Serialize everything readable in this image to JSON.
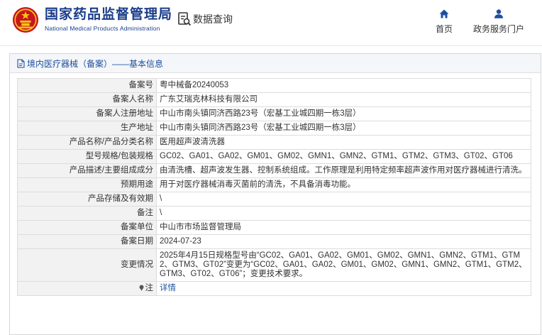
{
  "header": {
    "agency_cn": "国家药品监督管理局",
    "agency_en": "National Medical Products Administration",
    "query_label": "数据查询",
    "nav": [
      {
        "label": "首页",
        "icon": "home-icon"
      },
      {
        "label": "政务服务门户",
        "icon": "user-icon"
      }
    ]
  },
  "panel": {
    "title": "境内医疗器械（备案）——基本信息"
  },
  "rows": [
    {
      "label": "备案号",
      "value": "粤中械备20240053"
    },
    {
      "label": "备案人名称",
      "value": "广东艾瑞克林科技有限公司"
    },
    {
      "label": "备案人注册地址",
      "value": "中山市南头镇同济西路23号（宏基工业城四期一栋3层）"
    },
    {
      "label": "生产地址",
      "value": "中山市南头镇同济西路23号（宏基工业城四期一栋3层）"
    },
    {
      "label": "产品名称/产品分类名称",
      "value": "医用超声波清洗器"
    },
    {
      "label": "型号规格/包装规格",
      "value": "GC02、GA01、GA02、GM01、GM02、GMN1、GMN2、GTM1、GTM2、GTM3、GT02、GT06"
    },
    {
      "label": "产品描述/主要组成成分",
      "value": "由清洗槽、超声波发生器、控制系统组成。工作原理是利用特定频率超声波作用对医疗器械进行清洗。"
    },
    {
      "label": "预期用途",
      "value": "用于对医疗器械消毒灭菌前的清洗，不具备消毒功能。"
    },
    {
      "label": "产品存储及有效期",
      "value": "\\"
    },
    {
      "label": "备注",
      "value": "\\"
    },
    {
      "label": "备案单位",
      "value": "中山市市场监督管理局"
    },
    {
      "label": "备案日期",
      "value": "2024-07-23"
    },
    {
      "label": "变更情况",
      "value": "2025年4月15日规格型号由“GC02、GA01、GA02、GM01、GM02、GMN1、GMN2、GTM1、GTM2、GTM3、GT02”变更为“GC02、GA01、GA02、GM01、GM02、GMN1、GMN2、GTM1、GTM2、GTM3、GT02、GT06”；变更技术要求。"
    },
    {
      "label": "注",
      "value": "详情"
    }
  ]
}
